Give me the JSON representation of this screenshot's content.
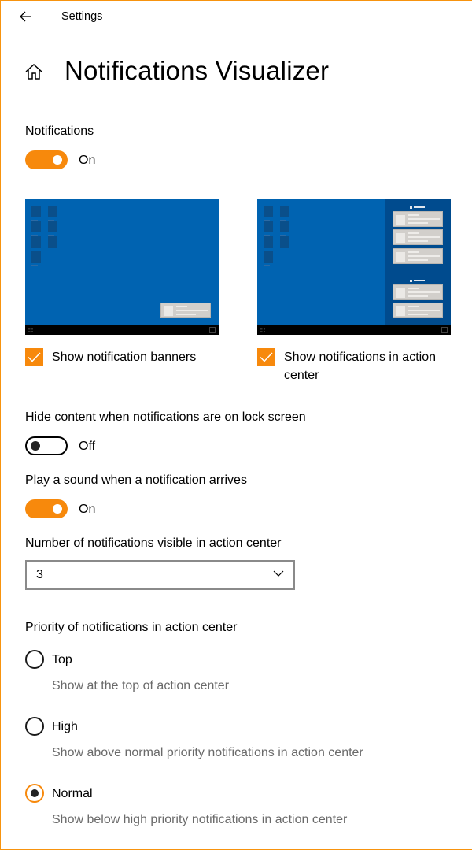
{
  "window": {
    "app_title": "Settings",
    "accent_color": "#f7890c",
    "back_icon": "back-arrow-icon"
  },
  "header": {
    "home_icon": "home-icon",
    "title": "Notifications Visualizer"
  },
  "notifications": {
    "label": "Notifications",
    "toggle_on": true,
    "state_text": "On"
  },
  "previews": {
    "banners": {
      "checkbox_label": "Show notification banners",
      "checked": true
    },
    "action_center": {
      "checkbox_label": "Show notifications in action center",
      "checked": true
    }
  },
  "hide_content": {
    "label": "Hide content when notifications are on lock screen",
    "toggle_on": false,
    "state_text": "Off"
  },
  "play_sound": {
    "label": "Play a sound when a notification arrives",
    "toggle_on": true,
    "state_text": "On"
  },
  "visible_count": {
    "label": "Number of notifications visible in action center",
    "selected": "3"
  },
  "priority": {
    "label": "Priority of notifications in action center",
    "options": [
      {
        "label": "Top",
        "description": "Show at the top of action center",
        "checked": false
      },
      {
        "label": "High",
        "description": "Show above normal priority notifications in action center",
        "checked": false
      },
      {
        "label": "Normal",
        "description": "Show below high priority notifications in action center",
        "checked": true
      }
    ]
  }
}
